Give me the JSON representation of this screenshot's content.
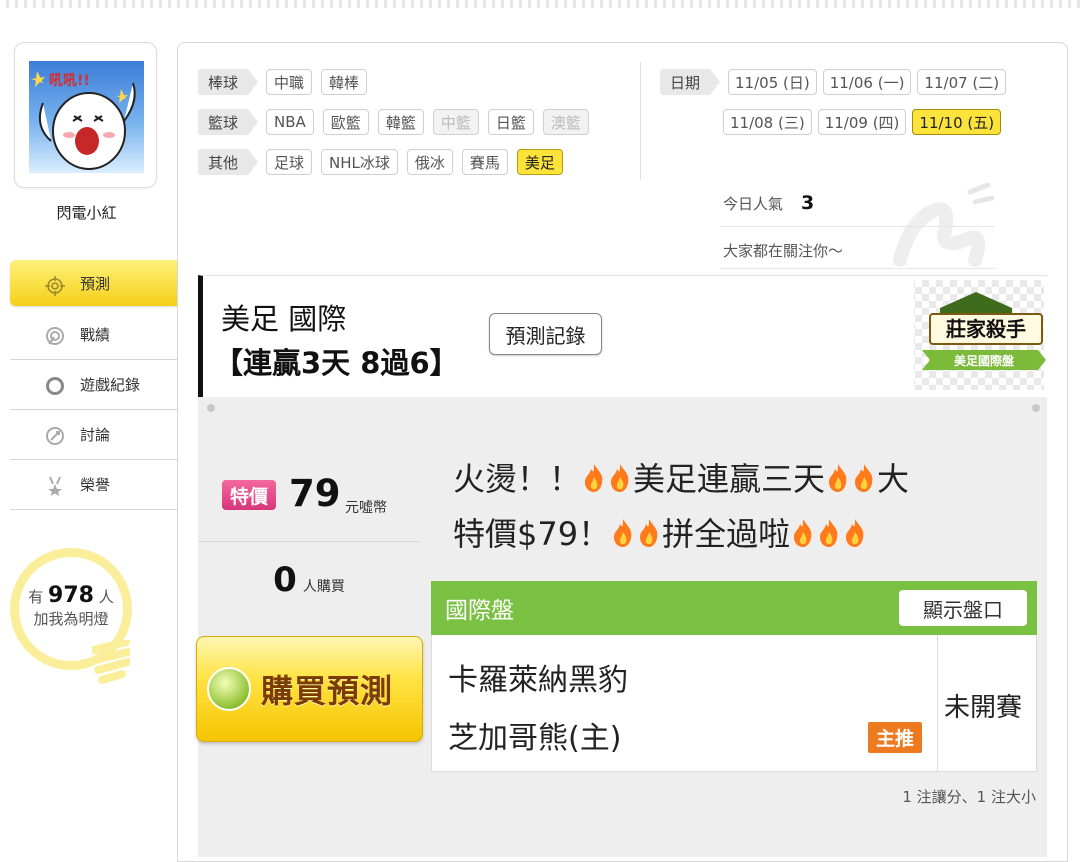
{
  "profile": {
    "name": "閃電小紅",
    "avatar_text": "吼吼!!"
  },
  "nav": [
    {
      "label": "預測",
      "icon": "target-icon",
      "active": true
    },
    {
      "label": "戰績",
      "icon": "chart-icon",
      "active": false
    },
    {
      "label": "遊戲紀錄",
      "icon": "ring-icon",
      "active": false
    },
    {
      "label": "討論",
      "icon": "chat-icon",
      "active": false
    },
    {
      "label": "榮譽",
      "icon": "medal-icon",
      "active": false
    }
  ],
  "fans": {
    "prefix": "有",
    "count": "978",
    "suffix": "人",
    "line2": "加我為明燈"
  },
  "categories": [
    {
      "label": "棒球",
      "items": [
        {
          "label": "中職"
        },
        {
          "label": "韓棒"
        }
      ]
    },
    {
      "label": "籃球",
      "items": [
        {
          "label": "NBA"
        },
        {
          "label": "歐籃"
        },
        {
          "label": "韓籃"
        },
        {
          "label": "中籃",
          "disabled": true
        },
        {
          "label": "日籃"
        },
        {
          "label": "澳籃",
          "disabled": true
        }
      ]
    },
    {
      "label": "其他",
      "items": [
        {
          "label": "足球"
        },
        {
          "label": "NHL冰球"
        },
        {
          "label": "俄冰"
        },
        {
          "label": "賽馬"
        },
        {
          "label": "美足",
          "selected": true
        }
      ]
    }
  ],
  "dates": {
    "label": "日期",
    "row1": [
      "11/05 (日)",
      "11/06 (一)",
      "11/07 (二)"
    ],
    "row2": [
      "11/08 (三)",
      "11/09 (四)",
      "11/10 (五)"
    ],
    "selected": "11/10 (五)"
  },
  "popularity": {
    "label": "今日人氣",
    "value": "3",
    "note": "大家都在關注你～"
  },
  "header": {
    "title_line1": "美足 國際",
    "title_line2": "【連贏3天 8過6】",
    "record_button": "預測記錄",
    "badge_title": "莊家殺手",
    "badge_sub": "美足國際盤"
  },
  "pricing": {
    "sale_tag": "特價",
    "price": "79",
    "unit": "元噓幣",
    "buyers_count": "0",
    "buyers_label": "人購買",
    "buy_button": "購買預測"
  },
  "promo": {
    "line1_a": "火燙！！",
    "line1_b": "美足連贏三天",
    "line1_c": "大",
    "line2_a": "特價$79！",
    "line2_b": "拼全過啦"
  },
  "match": {
    "market": "國際盤",
    "toggle_label": "顯示盤口",
    "away_team": "卡羅萊納黑豹",
    "home_team": "芝加哥熊(主)",
    "recommend_tag": "主推",
    "status": "未開賽"
  },
  "bets_summary": "1 注讓分、1 注大小",
  "colors": {
    "accent_yellow": "#fbe33c",
    "green": "#7ac143",
    "pink": "#e0468a",
    "orange": "#ee7a1f"
  }
}
